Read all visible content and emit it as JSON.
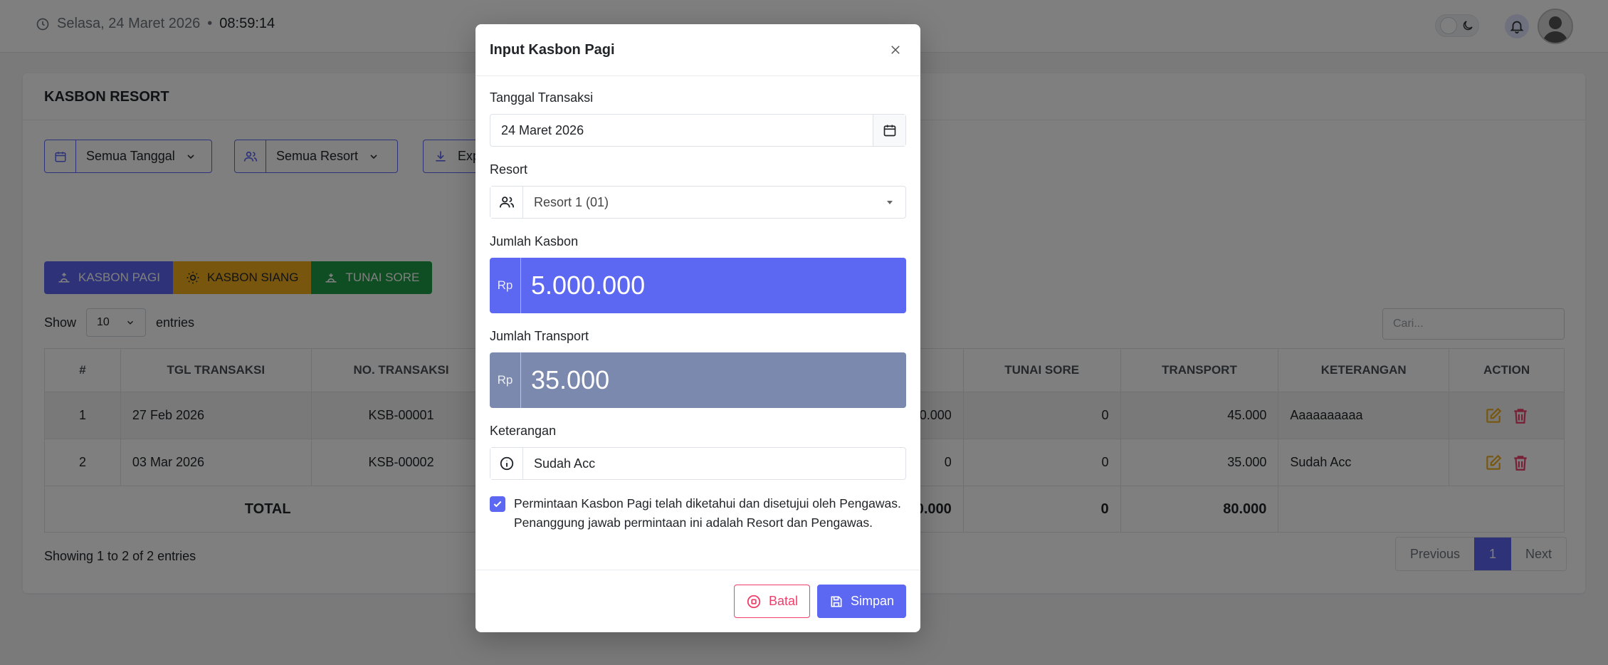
{
  "topbar": {
    "date": "Selasa, 24 Maret 2026",
    "separator": "•",
    "time": "08:59:14"
  },
  "page": {
    "card_title": "KASBON RESORT",
    "filters": {
      "date": "Semua Tanggal",
      "resort": "Semua Resort",
      "export": "Export"
    },
    "tabs": {
      "pagi": "KASBON PAGI",
      "siang": "KASBON SIANG",
      "sore": "TUNAI SORE"
    },
    "length": {
      "show": "Show",
      "value": "10",
      "entries": "entries"
    },
    "search_placeholder": "Cari...",
    "columns": [
      "#",
      "TGL TRANSAKSI",
      "NO. TRANSAKSI",
      "",
      "TUNAI SORE",
      "TRANSPORT",
      "KETERANGAN",
      "ACTION"
    ],
    "rows": [
      {
        "no": "1",
        "date": "27 Feb 2026",
        "trx": "KSB-00001",
        "amount": "000.000",
        "tunai_sore": "0",
        "transport": "45.000",
        "note": "Aaaaaaaaaa"
      },
      {
        "no": "2",
        "date": "03 Mar 2026",
        "trx": "KSB-00002",
        "amount": "0",
        "tunai_sore": "0",
        "transport": "35.000",
        "note": "Sudah Acc"
      }
    ],
    "total": {
      "label": "TOTAL",
      "amount": "00.000",
      "tunai_sore": "0",
      "transport": "80.000"
    },
    "info": "Showing 1 to 2 of 2 entries",
    "pager": {
      "prev": "Previous",
      "current": "1",
      "next": "Next"
    }
  },
  "modal": {
    "title": "Input Kasbon Pagi",
    "tanggal": {
      "label": "Tanggal Transaksi",
      "value": "24 Maret 2026"
    },
    "resort": {
      "label": "Resort",
      "value": "Resort 1 (01)"
    },
    "kasbon": {
      "label": "Jumlah Kasbon",
      "prefix": "Rp",
      "value": "5.000.000"
    },
    "transport": {
      "label": "Jumlah Transport",
      "prefix": "Rp",
      "value": "35.000"
    },
    "keterangan": {
      "label": "Keterangan",
      "value": "Sudah Acc"
    },
    "agreement": {
      "line1": "Permintaan Kasbon Pagi telah diketahui dan disetujui oleh Pengawas.",
      "line2": "Penanggung jawab permintaan ini adalah Resort dan Pengawas.",
      "checked": true
    },
    "buttons": {
      "cancel": "Batal",
      "save": "Simpan"
    }
  },
  "colors": {
    "primary": "#5c67f2",
    "warning": "#f0ad1c",
    "success": "#1f9b45",
    "danger": "#ef3f6b",
    "transport_bg": "#7a89ad"
  }
}
